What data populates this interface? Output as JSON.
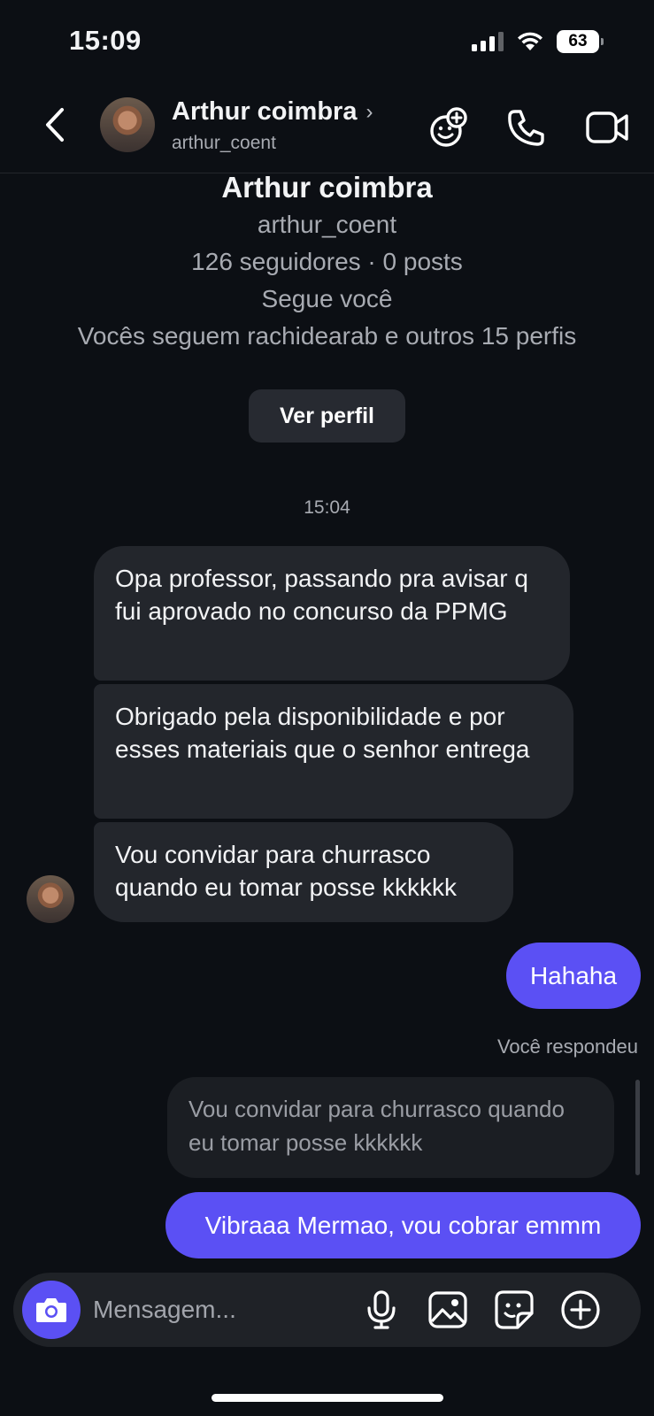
{
  "status_bar": {
    "time": "15:09",
    "battery": "63"
  },
  "header": {
    "name": "Arthur coimbra",
    "username": "arthur_coent"
  },
  "intro": {
    "name": "Arthur coimbra",
    "username": "arthur_coent",
    "stats": "126 seguidores · 0 posts",
    "follows_you": "Segue você",
    "mutuals": "Vocês seguem rachidearab e outros 15 perfis",
    "view_profile_label": "Ver perfil"
  },
  "timestamp": "15:04",
  "messages_in": [
    {
      "text": "Opa professor, passando pra avisar q fui aprovado no concurso da PPMG"
    },
    {
      "text": "Obrigado pela disponibilidade e por esses materiais que o senhor entrega"
    },
    {
      "text": "Vou convidar para churrasco quando eu tomar posse kkkkkk"
    }
  ],
  "messages_out": [
    {
      "text": "Hahaha"
    },
    {
      "text": "Vibraaa Mermao, vou cobrar emmm"
    }
  ],
  "reply": {
    "label": "Você respondeu",
    "quoted_text": "Vou convidar para churrasco quando eu tomar posse kkkkkk"
  },
  "composer": {
    "placeholder": "Mensagem..."
  },
  "colors": {
    "background": "#0c0f14",
    "accent": "#5b50f4",
    "bubble_in": "#23262c"
  }
}
